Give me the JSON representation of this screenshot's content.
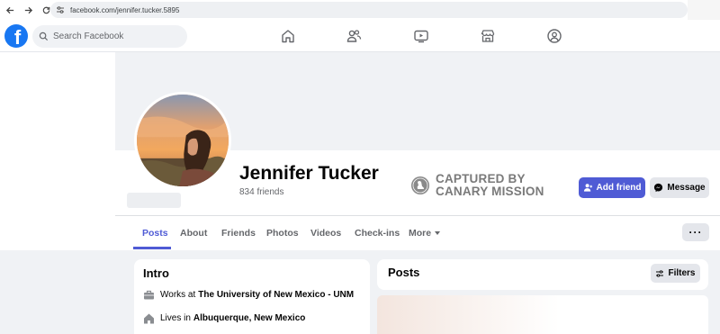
{
  "browser": {
    "url": "facebook.com/jennifer.tucker.5895"
  },
  "nav": {
    "logo": "f",
    "search_placeholder": "Search Facebook",
    "icons": [
      "home-icon",
      "friends-icon",
      "video-icon",
      "marketplace-icon",
      "groups-icon"
    ]
  },
  "profile": {
    "name": "Jennifer Tucker",
    "friends": "834 friends",
    "add_friend_label": "Add friend",
    "message_label": "Message",
    "more_dots": "···"
  },
  "watermark": {
    "line1": "CAPTURED BY",
    "line2": "CANARY MISSION"
  },
  "tabs": [
    {
      "label": "Posts",
      "active": true
    },
    {
      "label": "About",
      "active": false
    },
    {
      "label": "Friends",
      "active": false
    },
    {
      "label": "Photos",
      "active": false
    },
    {
      "label": "Videos",
      "active": false
    },
    {
      "label": "Check-ins",
      "active": false
    },
    {
      "label": "More",
      "active": false
    }
  ],
  "intro": {
    "title": "Intro",
    "works_prefix": "Works at",
    "works_value": "The University of New Mexico - UNM",
    "lives_prefix": "Lives in",
    "lives_value": "Albuquerque, New Mexico"
  },
  "posts": {
    "title": "Posts",
    "filters_label": "Filters"
  },
  "colors": {
    "accent": "#4f5bd5",
    "fb_blue": "#1877f2",
    "muted_text": "#65676b",
    "button_gray": "#e4e6eb"
  }
}
